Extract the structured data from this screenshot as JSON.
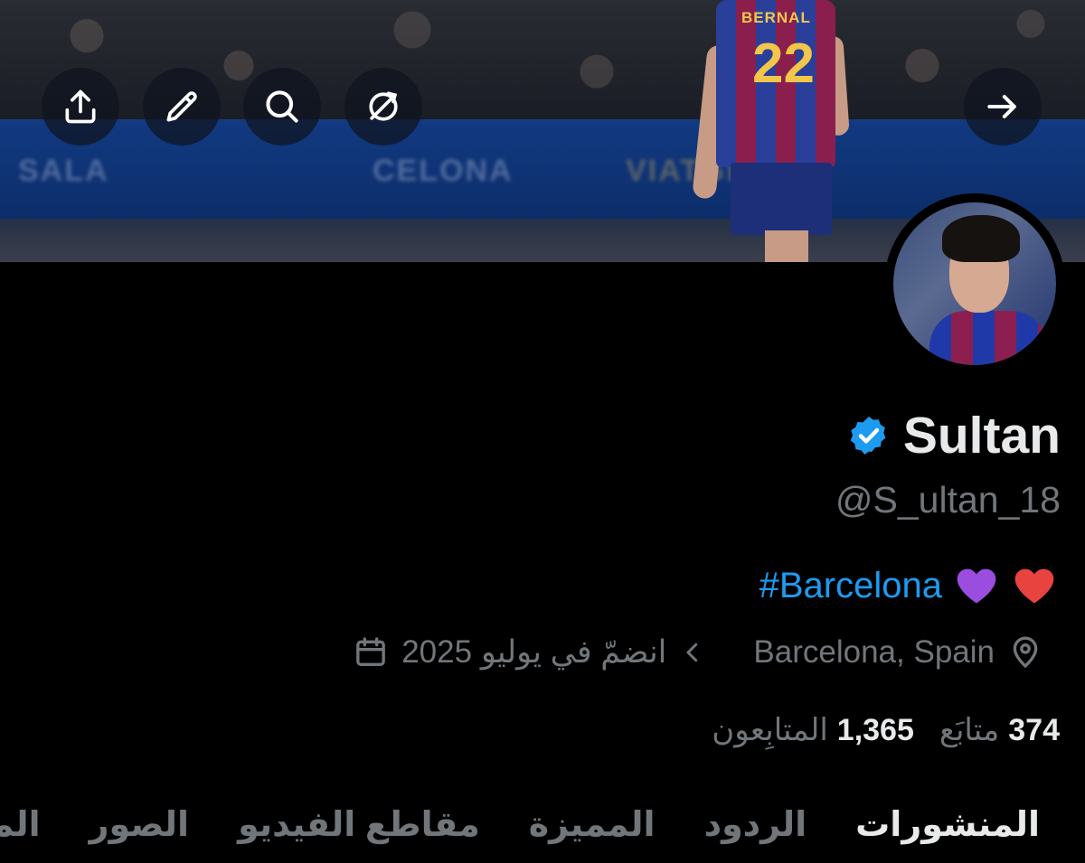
{
  "banner": {
    "player_name": "BERNAL",
    "player_number": "22",
    "board_texts": [
      "SALA",
      "CELONA",
      "VIATGE"
    ]
  },
  "toolbar": {
    "icons": [
      "share-icon",
      "edit-icon",
      "search-icon",
      "no-sync-icon",
      "arrow-right-icon"
    ]
  },
  "profile": {
    "display_name": "Sultan",
    "handle": "@S_ultan_18",
    "verified_color": "#1d9bf0",
    "bio_hashtag": "#Barcelona",
    "bio_emojis": [
      "purple-heart",
      "red-heart"
    ],
    "location": "Barcelona, Spain",
    "joined": "انضمّ في يوليو 2025",
    "following_count": "374",
    "following_label": "متابَع",
    "followers_count": "1,365",
    "followers_label": "المتابِعون"
  },
  "tabs": [
    {
      "label": "المنشورات",
      "active": true
    },
    {
      "label": "الردود",
      "active": false
    },
    {
      "label": "المميزة",
      "active": false
    },
    {
      "label": "مقاطع الفيديو",
      "active": false
    },
    {
      "label": "الصور",
      "active": false
    },
    {
      "label": "المقالات",
      "active": false
    }
  ],
  "colors": {
    "background": "#000000",
    "text_primary": "#e7e9ea",
    "text_secondary": "#71767b",
    "link": "#1d9bf0"
  }
}
